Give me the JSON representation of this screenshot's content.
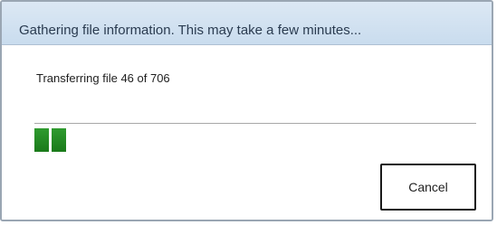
{
  "dialog": {
    "title": "Gathering file information. This may take a few minutes...",
    "status": "Transferring file 46 of 706",
    "progress": {
      "current": 46,
      "total": 706,
      "fraction": 0.065,
      "color": "#1e8a1e"
    },
    "cancel_label": "Cancel"
  }
}
